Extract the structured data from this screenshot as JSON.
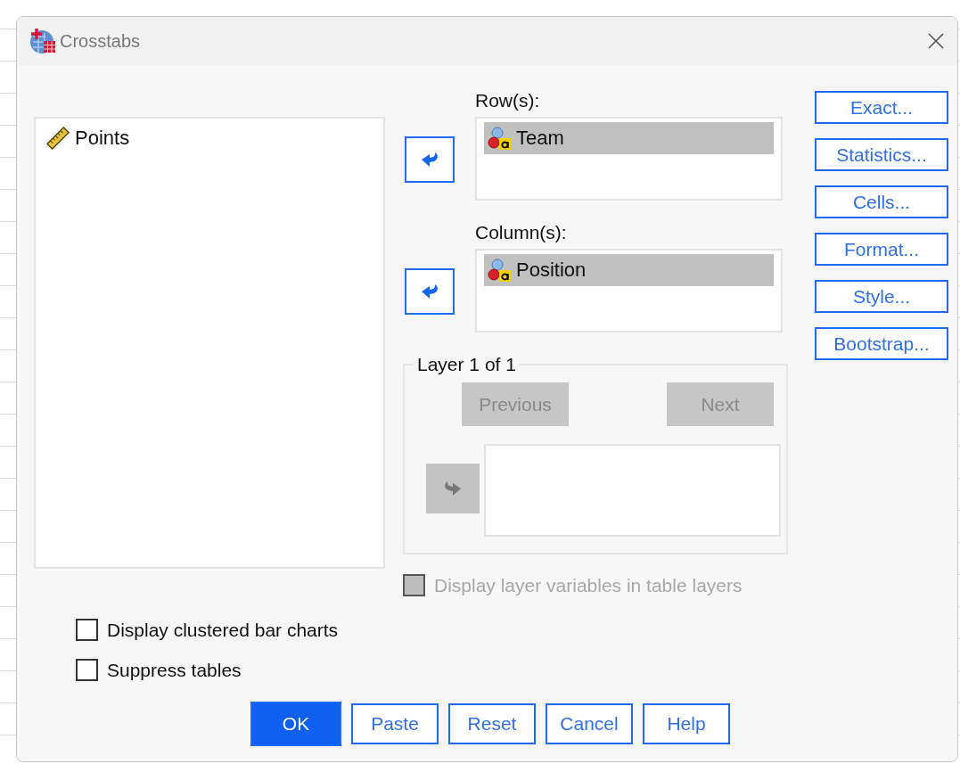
{
  "window": {
    "title": "Crosstabs"
  },
  "source_variables": [
    {
      "name": "Points",
      "kind": "scale",
      "selected": false
    }
  ],
  "rows": {
    "label": "Row(s):",
    "move_disabled": false,
    "variables": [
      {
        "name": "Team",
        "kind": "nominal",
        "selected": true
      }
    ]
  },
  "columns": {
    "label": "Column(s):",
    "move_disabled": false,
    "variables": [
      {
        "name": "Position",
        "kind": "nominal",
        "selected": true
      }
    ]
  },
  "layer": {
    "title": "Layer 1 of 1",
    "move_disabled": true,
    "buttons": [
      {
        "label": "Previous",
        "disabled": true
      },
      {
        "label": "Next",
        "disabled": true
      }
    ]
  },
  "display_layer_variables": {
    "label": "Display layer variables in table layers",
    "checked": false,
    "disabled": true
  },
  "side_buttons": [
    "Exact...",
    "Statistics...",
    "Cells...",
    "Format...",
    "Style...",
    "Bootstrap..."
  ],
  "options": [
    {
      "label": "Display clustered bar charts",
      "checked": false,
      "disabled": false
    },
    {
      "label": "Suppress tables",
      "checked": false,
      "disabled": false
    }
  ],
  "buttons": [
    {
      "label": "OK",
      "default": true
    },
    {
      "label": "Paste",
      "default": false
    },
    {
      "label": "Reset",
      "default": false
    },
    {
      "label": "Cancel",
      "default": false
    },
    {
      "label": "Help",
      "default": false
    }
  ]
}
